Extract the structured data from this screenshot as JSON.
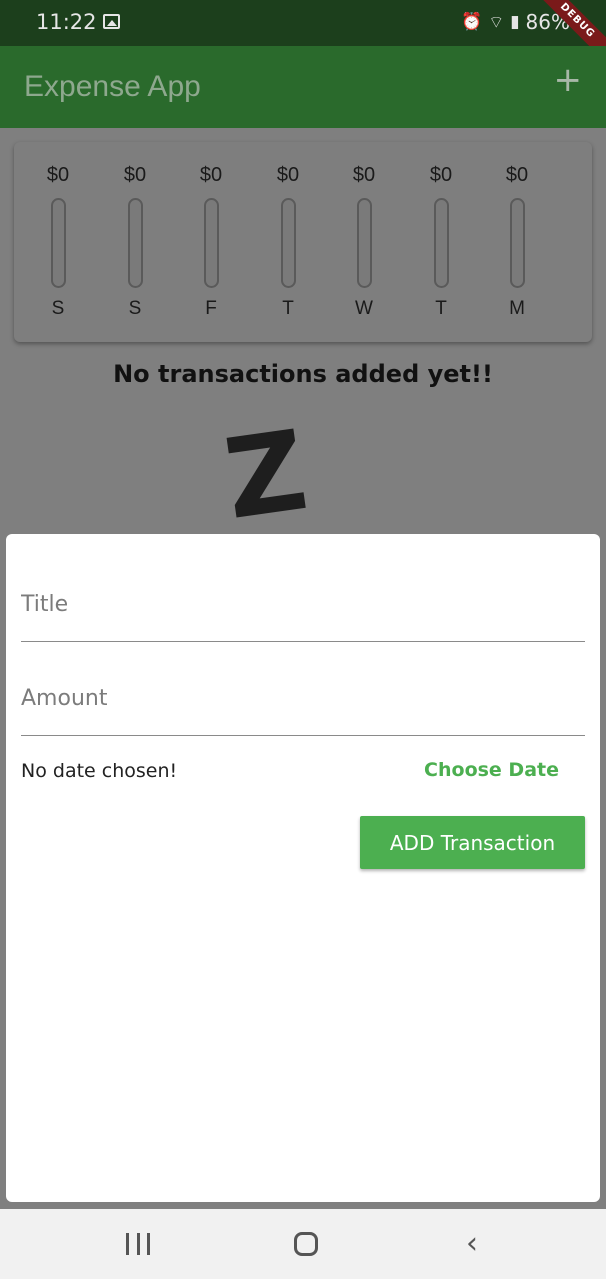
{
  "status_bar": {
    "time": "11:22",
    "battery": "86%",
    "debug_label": "DEBUG",
    "icons": [
      "gallery-icon",
      "alarm-icon",
      "wifi-icon",
      "signal-icon",
      "battery-icon"
    ]
  },
  "app_bar": {
    "title": "Expense App",
    "add_icon": "+"
  },
  "chart": {
    "bars": [
      {
        "amount": "$0",
        "day": "S",
        "fraction": 0
      },
      {
        "amount": "$0",
        "day": "S",
        "fraction": 0
      },
      {
        "amount": "$0",
        "day": "F",
        "fraction": 0
      },
      {
        "amount": "$0",
        "day": "T",
        "fraction": 0
      },
      {
        "amount": "$0",
        "day": "W",
        "fraction": 0
      },
      {
        "amount": "$0",
        "day": "T",
        "fraction": 0
      },
      {
        "amount": "$0",
        "day": "M",
        "fraction": 0
      }
    ]
  },
  "empty_state": {
    "message": "No transactions added yet!!",
    "image_glyph": "Z"
  },
  "form": {
    "title_placeholder": "Title",
    "title_value": "",
    "amount_placeholder": "Amount",
    "amount_value": "",
    "date_status": "No date chosen!",
    "choose_date_label": "Choose Date",
    "submit_label": "ADD Transaction"
  },
  "colors": {
    "primary": "#2a6a2c",
    "accent": "#4caf50"
  },
  "nav_bar": {
    "back_glyph": "‹"
  }
}
